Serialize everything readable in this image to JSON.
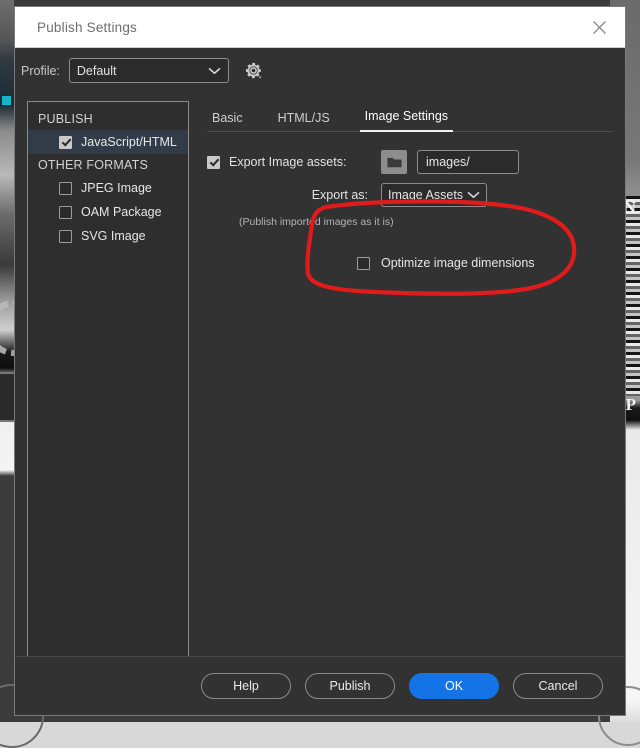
{
  "window": {
    "title": "Publish Settings",
    "close_icon": "close-icon"
  },
  "profile_bar": {
    "label": "Profile:",
    "selected": "Default",
    "options": [
      "Default"
    ],
    "chevron_icon": "chevron-down-icon",
    "gear_icon": "gear-icon"
  },
  "sidebar": {
    "groups": [
      {
        "title": "PUBLISH",
        "items": [
          {
            "label": "JavaScript/HTML",
            "checked": true,
            "selected": true
          }
        ]
      },
      {
        "title": "OTHER FORMATS",
        "items": [
          {
            "label": "JPEG Image",
            "checked": false,
            "selected": false
          },
          {
            "label": "OAM Package",
            "checked": false,
            "selected": false
          },
          {
            "label": "SVG Image",
            "checked": false,
            "selected": false
          }
        ]
      }
    ]
  },
  "tabs": [
    {
      "label": "Basic",
      "active": false
    },
    {
      "label": "HTML/JS",
      "active": false
    },
    {
      "label": "Image Settings",
      "active": true
    }
  ],
  "image_settings": {
    "export_assets": {
      "label": "Export Image assets:",
      "checked": true,
      "folder_icon": "folder-icon",
      "path_value": "images/",
      "path_placeholder": "images/"
    },
    "export_as": {
      "label": "Export as:",
      "selected": "Image Assets",
      "options": [
        "Image Assets"
      ],
      "chevron_icon": "chevron-down-icon"
    },
    "hint": "(Publish imported images as it is)",
    "optimize": {
      "label": "Optimize image dimensions",
      "checked": false
    }
  },
  "annotation": {
    "shape": "hand-drawn-ellipse",
    "color": "#e01b1b",
    "targets": "Optimize image dimensions"
  },
  "footer": {
    "buttons": [
      {
        "label": "Help",
        "primary": false
      },
      {
        "label": "Publish",
        "primary": false
      },
      {
        "label": "OK",
        "primary": true
      },
      {
        "label": "Cancel",
        "primary": false
      }
    ]
  },
  "background": {
    "letter_top": "N",
    "letter_bottom": "P"
  },
  "colors": {
    "accent": "#1473e6",
    "dialog_bg": "#323232",
    "titlebar_bg": "#ffffff",
    "selection": "#323c48",
    "annotation": "#e01b1b"
  }
}
